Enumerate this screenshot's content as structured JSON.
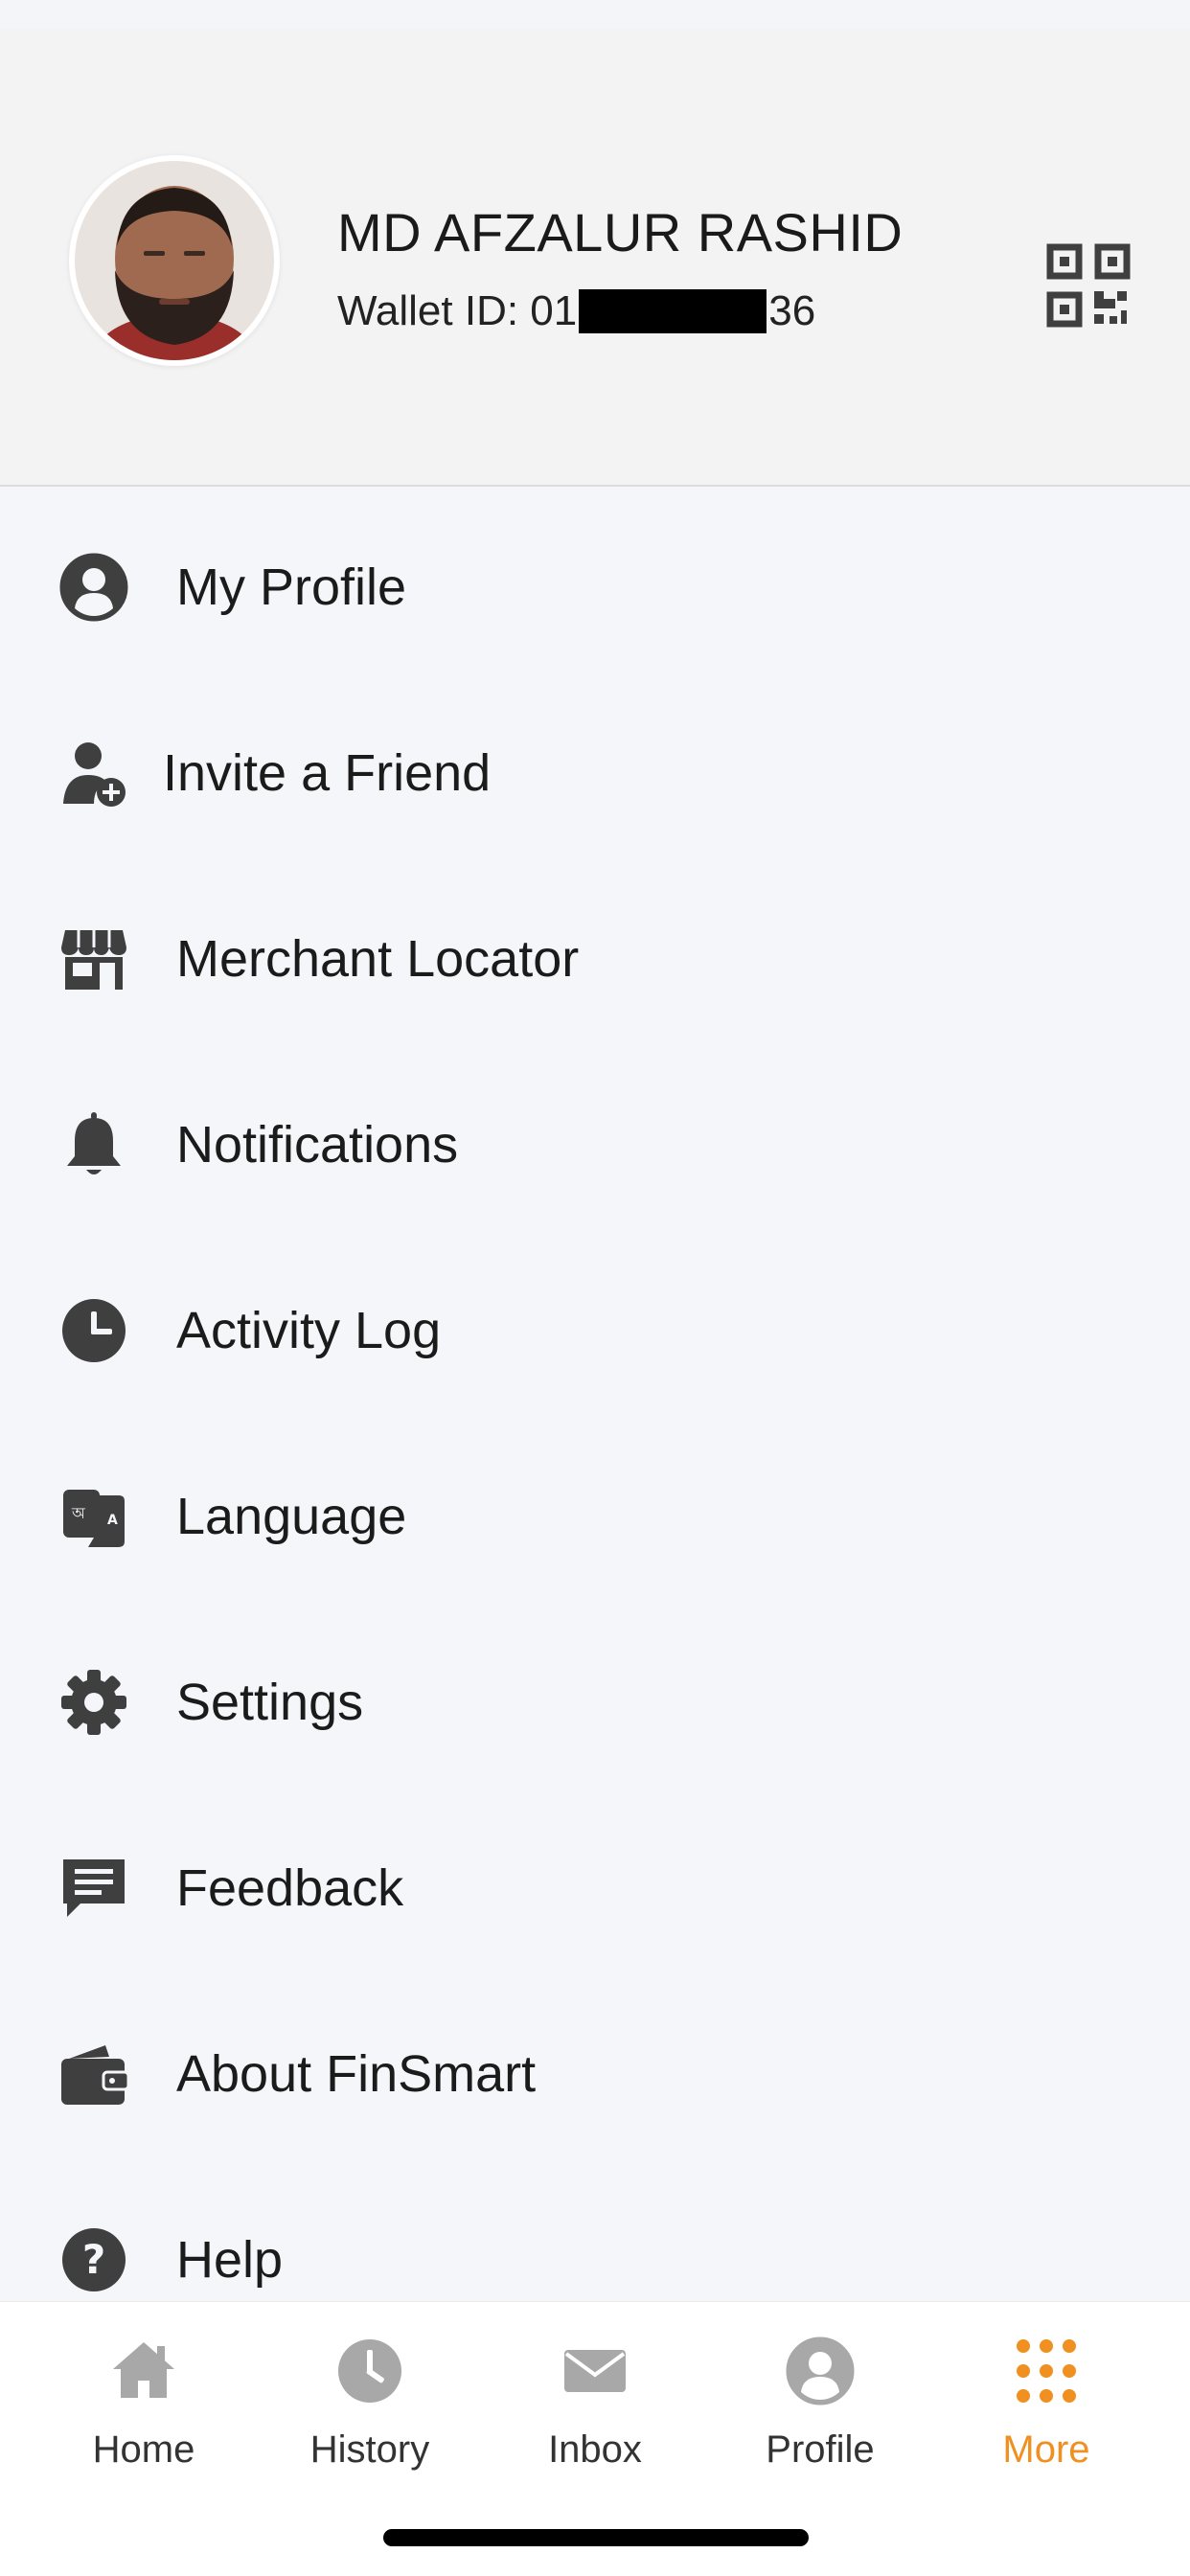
{
  "profile": {
    "name": "MD AFZALUR RASHID",
    "wallet_prefix": "Wallet ID: 01",
    "wallet_suffix": "36"
  },
  "icons": {
    "qr": "qr-code-icon"
  },
  "menu": {
    "items": [
      {
        "label": "My Profile",
        "icon": "user-circle-icon"
      },
      {
        "label": "Invite a Friend",
        "icon": "add-user-icon"
      },
      {
        "label": "Merchant Locator",
        "icon": "storefront-icon"
      },
      {
        "label": "Notifications",
        "icon": "bell-icon"
      },
      {
        "label": "Activity Log",
        "icon": "clock-icon"
      },
      {
        "label": "Language",
        "icon": "language-icon"
      },
      {
        "label": "Settings",
        "icon": "gear-icon"
      },
      {
        "label": "Feedback",
        "icon": "chat-icon"
      },
      {
        "label": "About FinSmart",
        "icon": "wallet-icon"
      },
      {
        "label": "Help",
        "icon": "help-icon"
      }
    ]
  },
  "tabbar": {
    "active": "More",
    "items": [
      {
        "label": "Home",
        "icon": "home-icon"
      },
      {
        "label": "History",
        "icon": "clock-icon"
      },
      {
        "label": "Inbox",
        "icon": "mail-icon"
      },
      {
        "label": "Profile",
        "icon": "user-circle-icon"
      },
      {
        "label": "More",
        "icon": "grid-dots-icon"
      }
    ]
  },
  "colors": {
    "accent": "#ef9020",
    "icon": "#3f3f3f",
    "tab_inactive": "#a8a8a8",
    "background": "#f5f6fa",
    "header": "#f3f3f3"
  }
}
